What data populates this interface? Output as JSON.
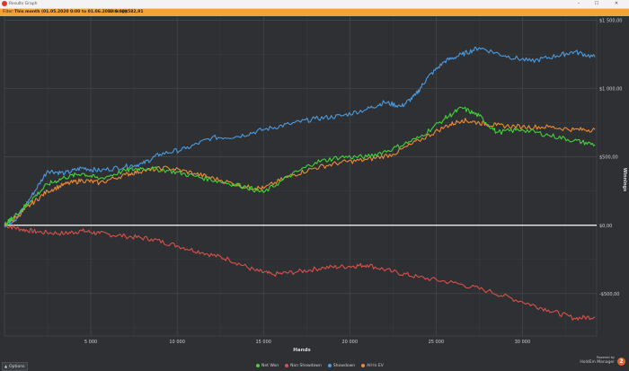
{
  "window": {
    "title": "Results Graph",
    "buttons": [
      "–",
      "☐",
      "✕"
    ]
  },
  "filter": {
    "prefix": "Filter:",
    "range": "This month (01.05.2020 0:00 to 01.06.2020 0:00)",
    "winnings_label": "Winnings:",
    "winnings_value": "$582,91"
  },
  "footer": {
    "options_label": "Options",
    "brand_sub": "Powered by",
    "brand_main": "HoldEm Manager",
    "brand_logo": "2"
  },
  "colors": {
    "net_won": "#3fd437",
    "non_showdown": "#d9504a",
    "showdown": "#4b9be0",
    "all_in_ev": "#ee8a34",
    "zero_line": "#ffffff",
    "grid": "#4a4d52",
    "background": "#2e3033"
  },
  "chart_data": {
    "type": "line",
    "xlabel": "Hands",
    "ylabel": "Winnings",
    "xlim": [
      0,
      34300
    ],
    "ylim": [
      -810,
      1530
    ],
    "xticks": [
      5000,
      10000,
      15000,
      20000,
      25000,
      30000
    ],
    "xtick_labels": [
      "5 000",
      "10 000",
      "15 000",
      "20 000",
      "25 000",
      "30 000"
    ],
    "yticks": [
      -500,
      0,
      500,
      1000,
      1500
    ],
    "ytick_labels": [
      "-$500,00",
      "$0,00",
      "$500,00",
      "$1 000,00",
      "$1 500,00"
    ],
    "grid": true,
    "legend_position": "bottom",
    "series": [
      {
        "name": "Non Showdown",
        "color_key": "non_showdown",
        "x": [
          0,
          1000,
          2000,
          3500,
          4500,
          5500,
          7000,
          8500,
          10000,
          11500,
          13000,
          14500,
          15500,
          17000,
          18500,
          20000,
          21000,
          22500,
          24000,
          26000,
          28000,
          30000,
          31500,
          33000,
          34200
        ],
        "y": [
          0,
          -30,
          -50,
          -60,
          -40,
          -60,
          -80,
          -100,
          -150,
          -200,
          -250,
          -330,
          -360,
          -340,
          -310,
          -300,
          -290,
          -340,
          -380,
          -420,
          -480,
          -560,
          -620,
          -680,
          -670
        ]
      },
      {
        "name": "Showdown",
        "color_key": "showdown",
        "x": [
          0,
          700,
          1500,
          2500,
          3500,
          4500,
          5500,
          7000,
          8000,
          9000,
          10500,
          12000,
          13500,
          15000,
          16500,
          18000,
          19500,
          21000,
          22000,
          23000,
          23800,
          24500,
          25500,
          26500,
          27500,
          29000,
          30500,
          32000,
          33000,
          34200
        ],
        "y": [
          0,
          50,
          200,
          400,
          380,
          420,
          400,
          430,
          450,
          520,
          560,
          640,
          650,
          700,
          740,
          780,
          800,
          850,
          900,
          870,
          950,
          1080,
          1200,
          1250,
          1300,
          1240,
          1200,
          1240,
          1270,
          1230
        ]
      },
      {
        "name": "All-In EV",
        "color_key": "all_in_ev",
        "x": [
          0,
          700,
          1500,
          2500,
          3500,
          4500,
          5500,
          7000,
          8000,
          9500,
          11000,
          12500,
          14000,
          15000,
          16500,
          18000,
          19500,
          21000,
          22500,
          24000,
          25500,
          26500,
          27500,
          28500,
          30000,
          31500,
          33000,
          34200
        ],
        "y": [
          0,
          60,
          150,
          250,
          300,
          330,
          310,
          370,
          400,
          420,
          380,
          330,
          280,
          270,
          360,
          420,
          460,
          480,
          520,
          620,
          720,
          770,
          750,
          730,
          720,
          720,
          700,
          700
        ]
      },
      {
        "name": "Net Won",
        "color_key": "net_won",
        "x": [
          0,
          700,
          1500,
          2500,
          3500,
          4500,
          5500,
          7000,
          8000,
          9500,
          11000,
          12500,
          14000,
          15000,
          16500,
          18000,
          19500,
          21000,
          22500,
          24000,
          25500,
          26500,
          27500,
          28500,
          30000,
          31500,
          33000,
          34200
        ],
        "y": [
          0,
          80,
          180,
          300,
          350,
          380,
          340,
          400,
          420,
          400,
          360,
          320,
          280,
          240,
          360,
          460,
          500,
          500,
          560,
          640,
          780,
          860,
          800,
          680,
          700,
          660,
          620,
          590
        ]
      }
    ]
  }
}
